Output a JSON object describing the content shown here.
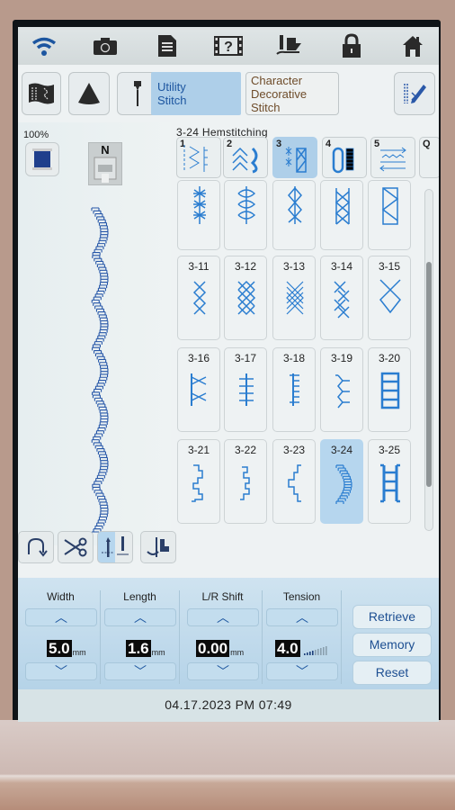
{
  "topbar": {
    "icons": [
      "wifi-icon",
      "camera-icon",
      "document-icon",
      "help-video-icon",
      "presser-foot-icon",
      "lock-icon",
      "home-icon"
    ]
  },
  "tabs": {
    "utility": {
      "line1": "Utility",
      "line2": "Stitch"
    },
    "character": {
      "line1": "Character",
      "line2": "Decorative",
      "line3": "Stitch"
    }
  },
  "left": {
    "zoom": "100%",
    "foot_letter": "N"
  },
  "stitch_title": "3-24 Hemstitching",
  "categories": [
    {
      "num": "1",
      "selected": false
    },
    {
      "num": "2",
      "selected": false
    },
    {
      "num": "3",
      "selected": true
    },
    {
      "num": "4",
      "selected": false
    },
    {
      "num": "5",
      "selected": false
    },
    {
      "num": "Q",
      "selected": false
    }
  ],
  "stitches": [
    {
      "label": "",
      "icon": "star-stitch"
    },
    {
      "label": "",
      "icon": "eye-stitch"
    },
    {
      "label": "",
      "icon": "diamond-stitch"
    },
    {
      "label": "",
      "icon": "lattice-stitch"
    },
    {
      "label": "",
      "icon": "triangle-stitch"
    },
    {
      "label": "3-11",
      "icon": "cross-3"
    },
    {
      "label": "3-12",
      "icon": "cross-4"
    },
    {
      "label": "3-13",
      "icon": "cross-dense"
    },
    {
      "label": "3-14",
      "icon": "x-chain"
    },
    {
      "label": "3-15",
      "icon": "cross-large"
    },
    {
      "label": "3-16",
      "icon": "bar-x"
    },
    {
      "label": "3-17",
      "icon": "bar-ticks"
    },
    {
      "label": "3-18",
      "icon": "bar-right-ticks"
    },
    {
      "label": "3-19",
      "icon": "feather"
    },
    {
      "label": "3-20",
      "icon": "boxes"
    },
    {
      "label": "3-21",
      "icon": "step-zigzag"
    },
    {
      "label": "3-22",
      "icon": "step-small"
    },
    {
      "label": "3-23",
      "icon": "step-left"
    },
    {
      "label": "3-24",
      "icon": "scallop",
      "selected": true
    },
    {
      "label": "3-25",
      "icon": "ladder"
    }
  ],
  "params": [
    {
      "label": "Width",
      "value": "5.0",
      "unit": "mm"
    },
    {
      "label": "Length",
      "value": "1.6",
      "unit": "mm"
    },
    {
      "label": "L/R Shift",
      "value": "0.00",
      "unit": "mm"
    },
    {
      "label": "Tension",
      "value": "4.0",
      "unit": ""
    }
  ],
  "tension_level": 0.4,
  "arrows": {
    "up": "︿",
    "down": "﹀"
  },
  "actions": {
    "retrieve": "Retrieve",
    "memory": "Memory",
    "reset": "Reset"
  },
  "status": "04.17.2023   PM 07:49",
  "colors": {
    "accent": "#1d56a0",
    "selected": "#aecfe9",
    "panel": "#c3ddee"
  }
}
